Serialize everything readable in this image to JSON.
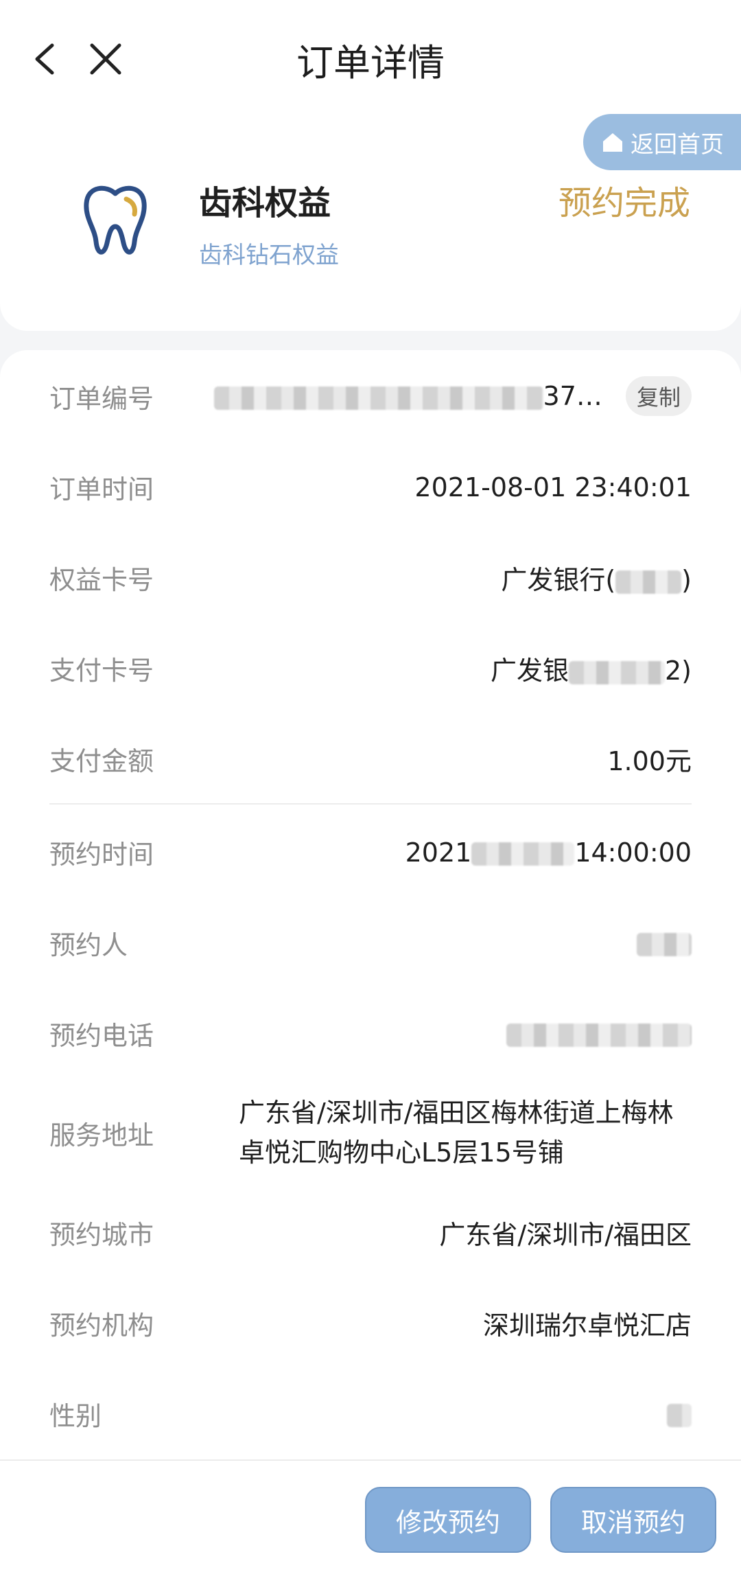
{
  "nav": {
    "title": "订单详情"
  },
  "header": {
    "home_button": "返回首页",
    "product_name": "齿科权益",
    "product_sub": "齿科钻石权益",
    "status": "预约完成"
  },
  "details": {
    "order_no": {
      "label": "订单编号",
      "value_tail": "37…",
      "copy": "复制"
    },
    "order_time": {
      "label": "订单时间",
      "value": "2021-08-01 23:40:01"
    },
    "benefit_card": {
      "label": "权益卡号",
      "value_prefix": "广发银行(",
      "value_suffix": ")"
    },
    "pay_card": {
      "label": "支付卡号",
      "value_prefix": "广发银",
      "value_suffix": "2)"
    },
    "pay_amount": {
      "label": "支付金额",
      "value": "1.00元"
    },
    "appt_time": {
      "label": "预约时间",
      "value_prefix": "2021",
      "value_suffix": "14:00:00"
    },
    "appt_person": {
      "label": "预约人"
    },
    "appt_phone": {
      "label": "预约电话"
    },
    "service_addr": {
      "label": "服务地址",
      "value": "广东省/深圳市/福田区梅林街道上梅林卓悦汇购物中心L5层15号铺"
    },
    "appt_city": {
      "label": "预约城市",
      "value": "广东省/深圳市/福田区"
    },
    "appt_org": {
      "label": "预约机构",
      "value": "深圳瑞尔卓悦汇店"
    },
    "gender": {
      "label": "性别"
    }
  },
  "actions": {
    "modify": "修改预约",
    "cancel": "取消预约"
  },
  "colors": {
    "accent": "#86aedb",
    "status": "#caa150",
    "sub": "#7fa3cf"
  }
}
